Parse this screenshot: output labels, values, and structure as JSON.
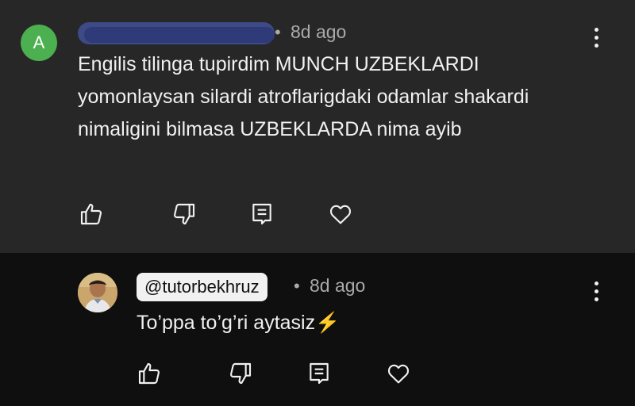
{
  "comments": [
    {
      "avatar_letter": "A",
      "timestamp": "8d ago",
      "text": "Engilis tilinga tupirdim MUNCH UZBEKLARDI yomonlaysan silardi atroflarigdaki odamlar shakardi nimaligini bilmasa UZBEKLARDA nima ayib"
    },
    {
      "handle": "@tutorbekhruz",
      "timestamp": "8d ago",
      "text": "To’ppa to’g’ri aytasiz",
      "emoji": "⚡"
    }
  ],
  "separator": "•",
  "icons": {
    "like": "thumbs-up-icon",
    "dislike": "thumbs-down-icon",
    "reply": "reply-icon",
    "heart": "heart-icon",
    "more": "more-vertical-icon"
  },
  "colors": {
    "avatar_bg": "#4caf50",
    "first_comment_bg": "#272727",
    "page_bg": "#0f0f0f",
    "handle_bg": "#f1f1f1"
  }
}
